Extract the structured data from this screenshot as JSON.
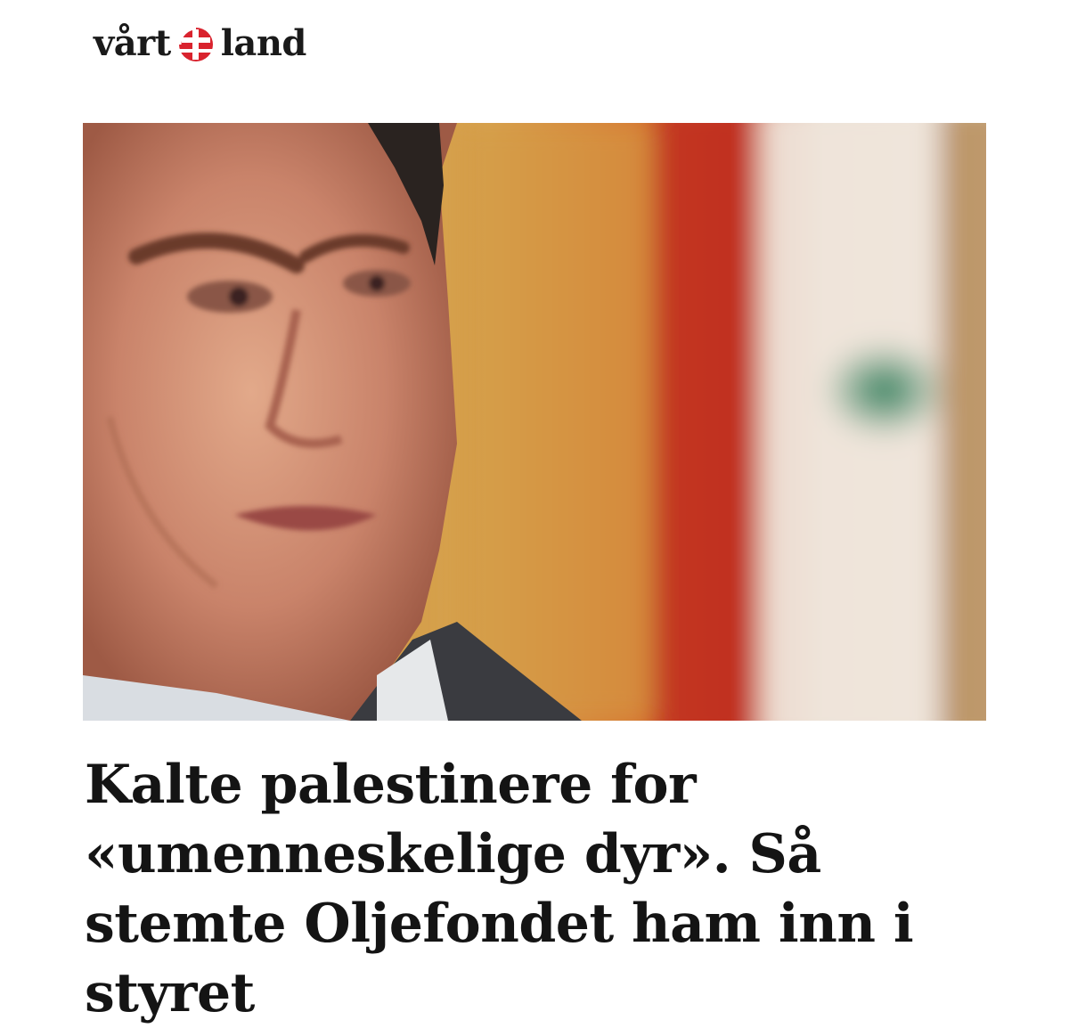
{
  "masthead": {
    "brand_left": "vårt",
    "brand_right": "land",
    "logo_icon": "cross-emblem-icon",
    "colors": {
      "logo_red": "#d9232e",
      "text": "#1a1a1a"
    }
  },
  "article": {
    "headline": "Kalte palestinere for «umenneskelige dyr». Så stemte Oljefondet ham inn i styret",
    "hero_image": "portrait-photo"
  }
}
